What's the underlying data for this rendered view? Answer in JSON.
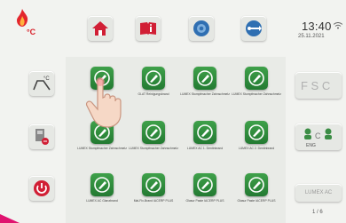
{
  "header": {
    "temperature_unit": "°C",
    "time": "13:40",
    "date": "25.11.2021"
  },
  "nav": {
    "home_icon": "home-icon",
    "info_icon": "info-icon",
    "vacuum_icon": "vacuum-icon",
    "usb_icon": "usb-icon"
  },
  "sidebar": [
    {
      "name": "temperature-curve-button",
      "icon": "temperature-curve-icon"
    },
    {
      "name": "pressing-button",
      "icon": "press-icon"
    },
    {
      "name": "power-button",
      "icon": "power-icon"
    }
  ],
  "programs": [
    {
      "label": ""
    },
    {
      "label": "GLAT Reinigungsbrand"
    },
    {
      "label": "LUMEX Stumpfmacher Zahnschmelz"
    },
    {
      "label": "LUMEX Stumpfmacher Zahnschmelz"
    },
    {
      "label": "LUMEX Stumpfmacher Zahnschmelz"
    },
    {
      "label": "LUMEX Stumpfmacher Zahnschmelz"
    },
    {
      "label": "LUMEX AC 1. Dentinbrand"
    },
    {
      "label": "LUMEX AC 2. Dentinbrand"
    },
    {
      "label": "LUMEX AC Glanzbrand"
    },
    {
      "label": "Mal-Fix-Brand IACERP PLUS"
    },
    {
      "label": "Glasur Paste IACERP PLUS"
    },
    {
      "label": "Glasur Paste IACERP PLUS"
    }
  ],
  "right_panel": {
    "label_bottom": "LUMEX AC",
    "page": "1 / 6",
    "language_labels": [
      "ENG"
    ]
  }
}
